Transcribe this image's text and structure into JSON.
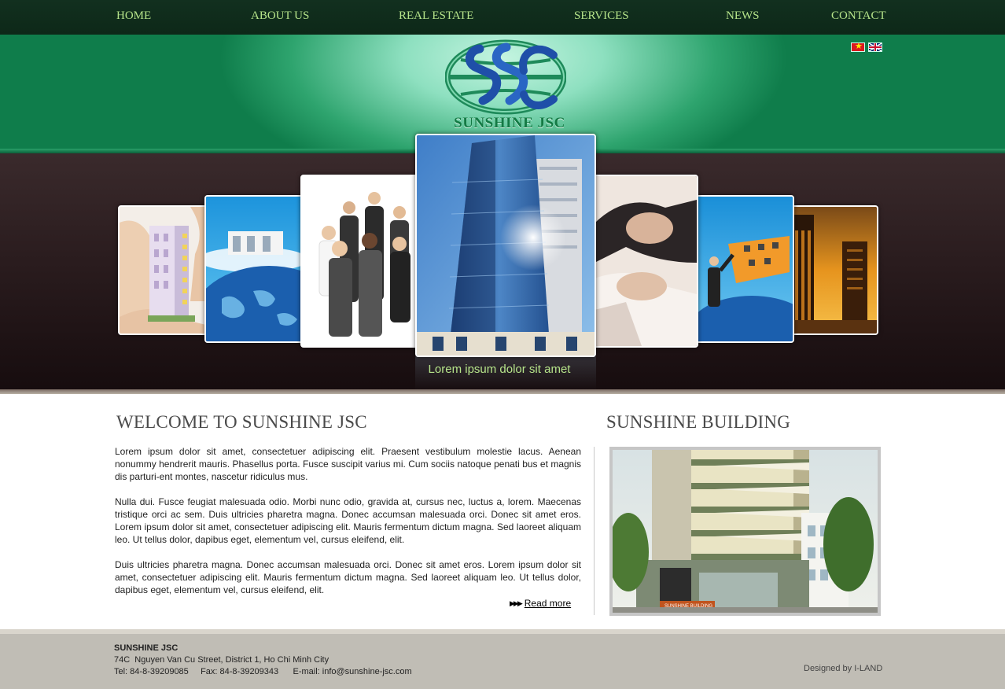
{
  "nav": {
    "items": [
      {
        "label": "HOME"
      },
      {
        "label": "ABOUT US"
      },
      {
        "label": "REAL ESTATE"
      },
      {
        "label": "SERVICES"
      },
      {
        "label": "NEWS"
      },
      {
        "label": "CONTACT"
      }
    ]
  },
  "header": {
    "logo_text": "SUNSHINE JSC",
    "flags": [
      "vietnamese-flag-icon",
      "english-flag-icon"
    ]
  },
  "banner": {
    "caption": "Lorem ipsum dolor sit amet",
    "images": [
      "hands-holding-building-photo",
      "globe-office-photo",
      "business-team-photo",
      "glass-skyscraper-photo",
      "handshake-photo",
      "businessman-globe-photo",
      "sunset-towers-photo"
    ]
  },
  "welcome": {
    "title": "WELCOME TO SUNSHINE JSC",
    "paragraphs": [
      "Lorem ipsum dolor sit amet, consectetuer adipiscing elit. Praesent vestibulum molestie lacus. Aenean nonummy hendrerit mauris. Phasellus porta. Fusce suscipit varius mi. Cum sociis natoque penati bus et magnis dis parturi-ent montes, nascetur ridiculus mus.",
      "Nulla dui. Fusce feugiat malesuada odio. Morbi nunc odio, gravida at, cursus nec, luctus a, lorem. Maecenas tristique orci ac sem. Duis ultricies pharetra magna. Donec accumsan malesuada orci. Donec sit amet eros. Lorem ipsum dolor sit amet, consectetuer adipiscing elit. Mauris fermentum dictum magna. Sed laoreet aliquam leo. Ut tellus dolor, dapibus eget, elementum vel, cursus eleifend, elit.",
      "Duis ultricies pharetra magna. Donec accumsan malesuada orci. Donec sit amet eros. Lorem ipsum dolor sit amet, consectetuer adipiscing elit. Mauris fermentum dictum magna. Sed laoreet aliquam leo. Ut tellus dolor, dapibus eget, elementum vel, cursus eleifend, elit."
    ],
    "read_more": "Read more"
  },
  "building": {
    "title": "SUNSHINE BUILDING",
    "sign_text": "SUNSHINE BUILDING"
  },
  "footer": {
    "company": "SUNSHINE JSC",
    "address": "74C  Nguyen Van Cu Street, District 1, Ho Chi Minh City",
    "contact": "Tel: 84-8-39209085     Fax: 84-8-39209343      E-mail: info@sunshine-jsc.com",
    "credit": "Designed by I-LAND"
  },
  "colors": {
    "nav_bg": "#12301f",
    "nav_text": "#b6e48a",
    "header_green": "#0f7d4b",
    "banner_bg": "#2a1c1e",
    "footer_bg": "#c0bdb5"
  }
}
